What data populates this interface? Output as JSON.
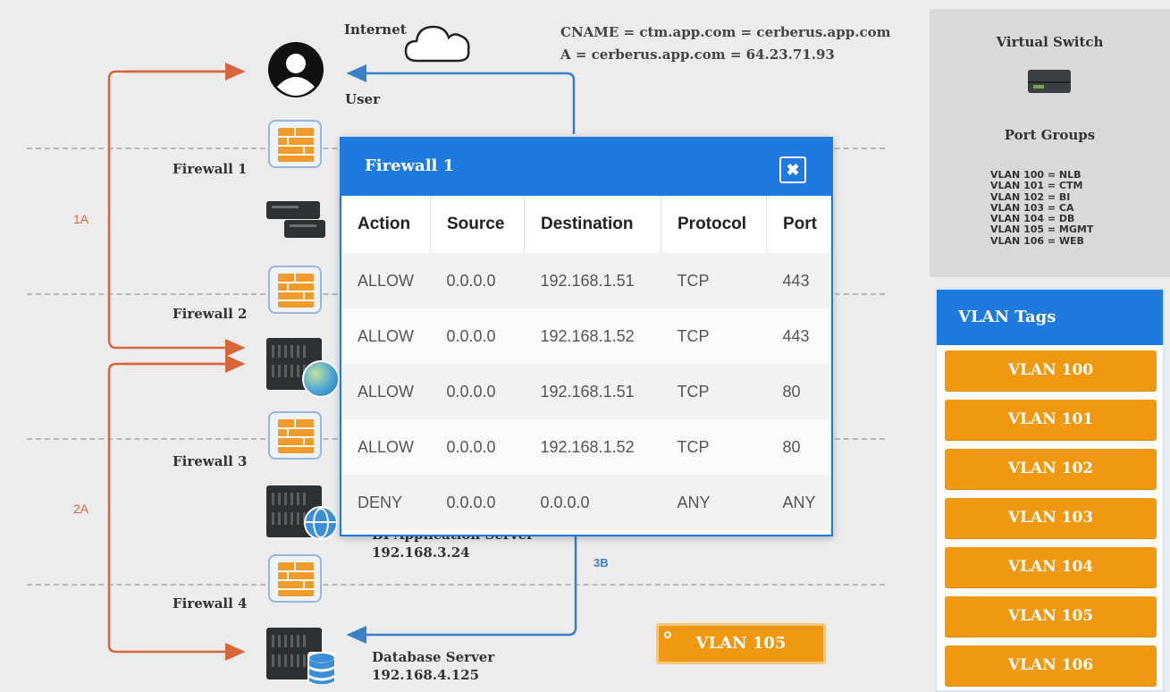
{
  "diagram": {
    "internet_label": "Internet",
    "user_label": "User",
    "dns_line1": "CNAME = ctm.app.com = cerberus.app.com",
    "dns_line2": "A = cerberus.app.com = 64.23.71.93",
    "firewalls": [
      "Firewall 1",
      "Firewall 2",
      "Firewall 3",
      "Firewall 4"
    ],
    "paths": [
      "1A",
      "2A",
      "3B"
    ],
    "bi_server": {
      "name": "BI Application Server",
      "ip": "192.168.3.24"
    },
    "db_server": {
      "name": "Database Server",
      "ip": "192.168.4.125"
    },
    "placed_tag": "VLAN 105"
  },
  "virtual_switch": {
    "title": "Virtual Switch",
    "port_groups_title": "Port Groups",
    "port_groups": [
      "VLAN 100 = NLB",
      "VLAN 101 = CTM",
      "VLAN 102 = BI",
      "VLAN 103 = CA",
      "VLAN 104 = DB",
      "VLAN 105 = MGMT",
      "VLAN 106 = WEB"
    ]
  },
  "vlan_tags": {
    "title": "VLAN Tags",
    "tags": [
      "VLAN 100",
      "VLAN 101",
      "VLAN 102",
      "VLAN 103",
      "VLAN 104",
      "VLAN 105",
      "VLAN 106"
    ]
  },
  "modal": {
    "title": "Firewall 1",
    "close_symbol": "✖",
    "columns": [
      "Action",
      "Source",
      "Destination",
      "Protocol",
      "Port"
    ],
    "rows": [
      [
        "ALLOW",
        "0.0.0.0",
        "192.168.1.51",
        "TCP",
        "443"
      ],
      [
        "ALLOW",
        "0.0.0.0",
        "192.168.1.52",
        "TCP",
        "443"
      ],
      [
        "ALLOW",
        "0.0.0.0",
        "192.168.1.51",
        "TCP",
        "80"
      ],
      [
        "ALLOW",
        "0.0.0.0",
        "192.168.1.52",
        "TCP",
        "80"
      ],
      [
        "DENY",
        "0.0.0.0",
        "0.0.0.0",
        "ANY",
        "ANY"
      ]
    ]
  },
  "colors": {
    "accent_blue": "#1f7ae0",
    "vlan_orange": "#f0980f",
    "path_orange": "#d9653b",
    "path_blue": "#3b7fc7"
  },
  "icons": [
    "user-icon",
    "cloud-icon",
    "firewall-icon",
    "server-icon",
    "globe-icon",
    "database-icon",
    "switch-icon",
    "close-icon"
  ]
}
